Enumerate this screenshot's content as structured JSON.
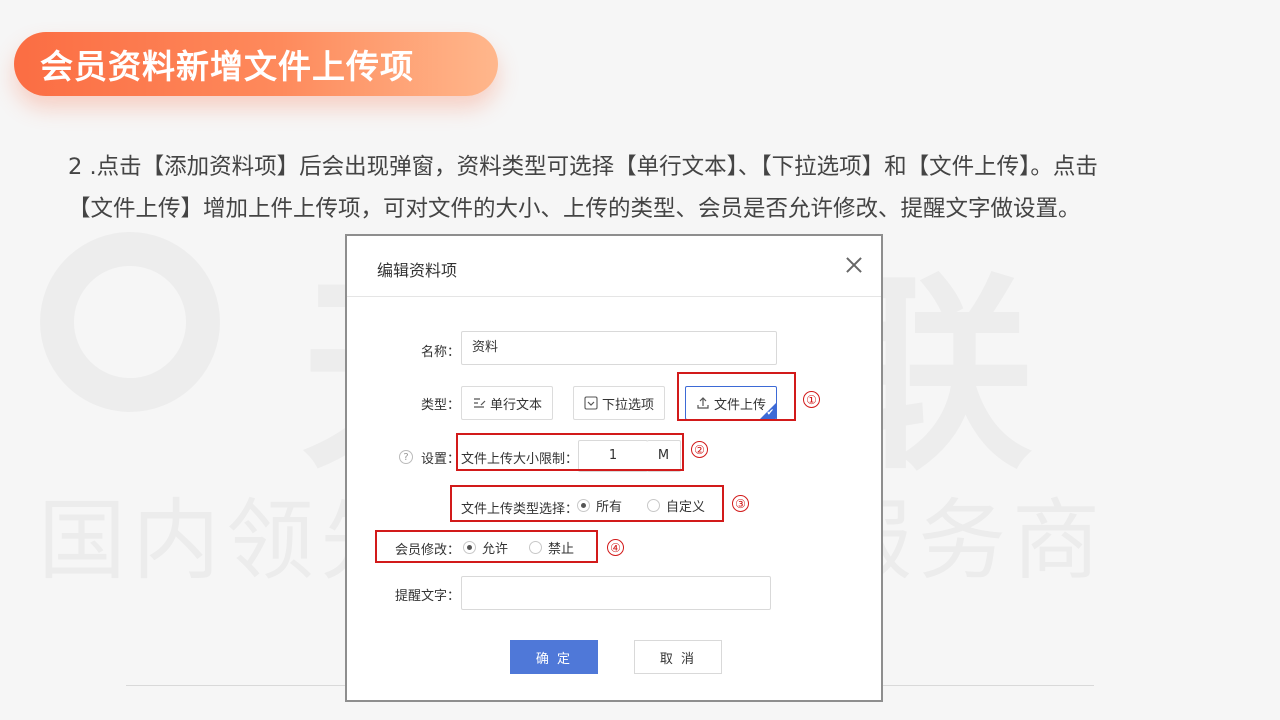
{
  "title": "会员资料新增文件上传项",
  "paragraph": {
    "line1": "2 .点击【添加资料项】后会出现弹窗，资料类型可选择【单行文本】、【下拉选项】和【文件上传】。点击",
    "line2": "【文件上传】增加上件上传项，可对文件的大小、上传的类型、会员是否允许修改、提醒文字做设置。"
  },
  "watermark": {
    "ring_char": "",
    "big": "天       互联",
    "sub": "国内领先的         化营销服务商"
  },
  "dialog": {
    "title": "编辑资料项",
    "name_label": "名称：",
    "name_value": "资料",
    "type_label": "类型：",
    "type_options": [
      "单行文本",
      "下拉选项",
      "文件上传"
    ],
    "selected_type": "文件上传",
    "settings_label": "设置：",
    "size_limit_label": "文件上传大小限制：",
    "size_limit_value": "1",
    "size_unit": "M",
    "file_type_label": "文件上传类型选择：",
    "file_type_options": [
      "所有",
      "自定义"
    ],
    "file_type_selected": "所有",
    "member_edit_label": "会员修改：",
    "member_edit_options": [
      "允许",
      "禁止"
    ],
    "member_edit_selected": "允许",
    "reminder_label": "提醒文字：",
    "reminder_value": "",
    "ok_label": "确 定",
    "cancel_label": "取 消"
  },
  "annotations": [
    "①",
    "②",
    "③",
    "④"
  ],
  "colors": {
    "accent": "#fb6d43",
    "highlight": "#d21a1a",
    "primary_button": "#4f78d8"
  }
}
